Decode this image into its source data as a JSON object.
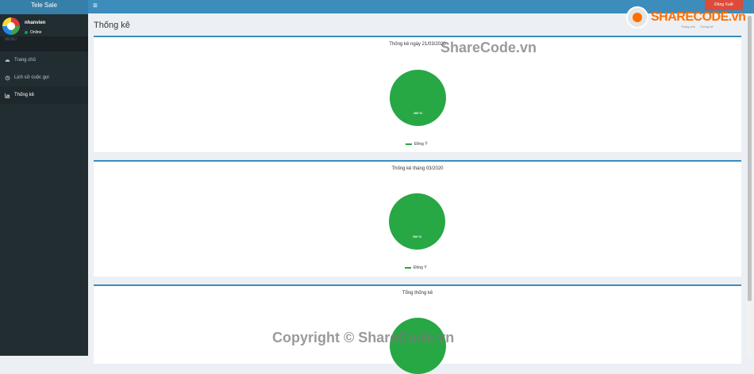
{
  "app": {
    "title": "Tele Sale"
  },
  "user": {
    "name": "nhanvien",
    "status": "Online"
  },
  "sidebar": {
    "menu_header": "MENU",
    "items": [
      {
        "label": "Trang chủ",
        "icon": "dashboard-icon"
      },
      {
        "label": "Lịch sử cuộc gọi",
        "icon": "history-icon"
      },
      {
        "label": "Thống kê",
        "icon": "bar-chart-icon",
        "active": true
      }
    ]
  },
  "topbar": {
    "logout_label": "Đăng Xuất"
  },
  "breadcrumb": [
    "Trang chủ",
    "Thống kê"
  ],
  "page": {
    "title": "Thống kê"
  },
  "chart_data": [
    {
      "type": "pie",
      "title": "Thống kê ngày 21/03/2020",
      "categories": [
        "Đồng Ý"
      ],
      "values": [
        100
      ],
      "slice_labels": [
        "100 %"
      ]
    },
    {
      "type": "pie",
      "title": "Thống kê tháng 03/2020",
      "categories": [
        "Đồng Ý"
      ],
      "values": [
        100
      ],
      "slice_labels": [
        "100 %"
      ]
    },
    {
      "type": "pie",
      "title": "Tổng thống kê",
      "categories": [],
      "values": [
        100
      ]
    }
  ],
  "colors": {
    "pie_slice": "#28a745",
    "primary": "#3c8dbc",
    "sidebar": "#222d32",
    "logout": "#dd4b39"
  },
  "watermark": {
    "logo_text": "SHARECODE.vn",
    "mid_text": "ShareCode.vn",
    "bottom_text": "Copyright © ShareCode.vn"
  }
}
